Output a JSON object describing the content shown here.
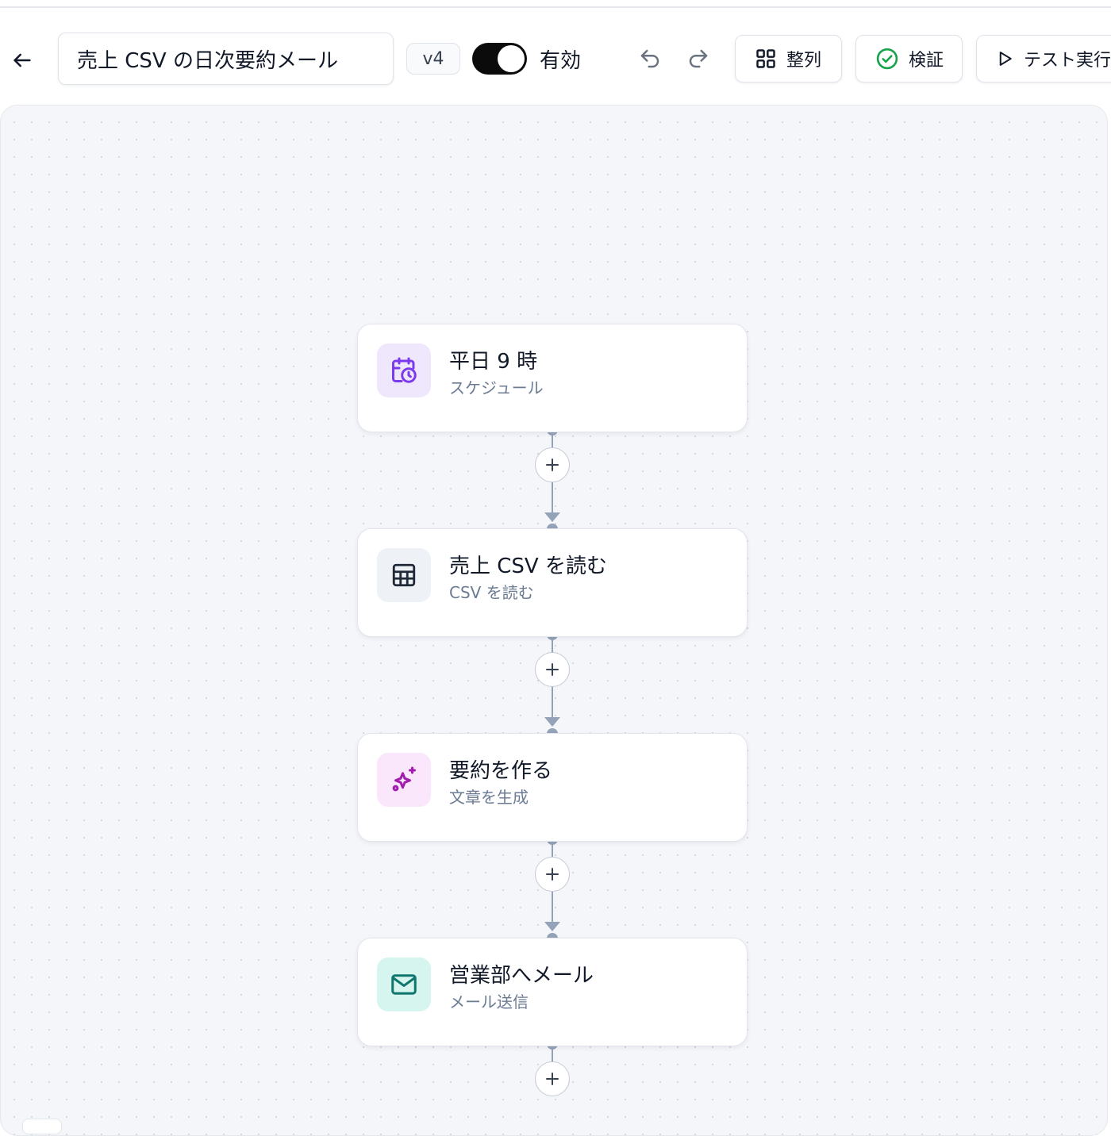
{
  "header": {
    "workflow_title": "売上 CSV の日次要約メール",
    "version": "v4",
    "enabled_label": "有効",
    "enabled": true,
    "arrange_label": "整列",
    "validate_label": "検証",
    "test_run_label": "テスト実行"
  },
  "nodes": [
    {
      "title": "平日 9 時",
      "subtitle": "スケジュール",
      "icon": "calendar-clock-icon",
      "icon_bg": "#efe8fd",
      "icon_color": "#7c3aed"
    },
    {
      "title": "売上 CSV を読む",
      "subtitle": "CSV を読む",
      "icon": "table-icon",
      "icon_bg": "#eef1f5",
      "icon_color": "#1f2937"
    },
    {
      "title": "要約を作る",
      "subtitle": "文章を生成",
      "icon": "sparkles-icon",
      "icon_bg": "#fbe7fb",
      "icon_color": "#a21caf"
    },
    {
      "title": "営業部へメール",
      "subtitle": "メール送信",
      "icon": "mail-icon",
      "icon_bg": "#d5f5ee",
      "icon_color": "#0f766e"
    }
  ],
  "colors": {
    "connector": "#94a3b8",
    "validate_check": "#16a34a",
    "toggle_on": "#0b0b0b"
  }
}
